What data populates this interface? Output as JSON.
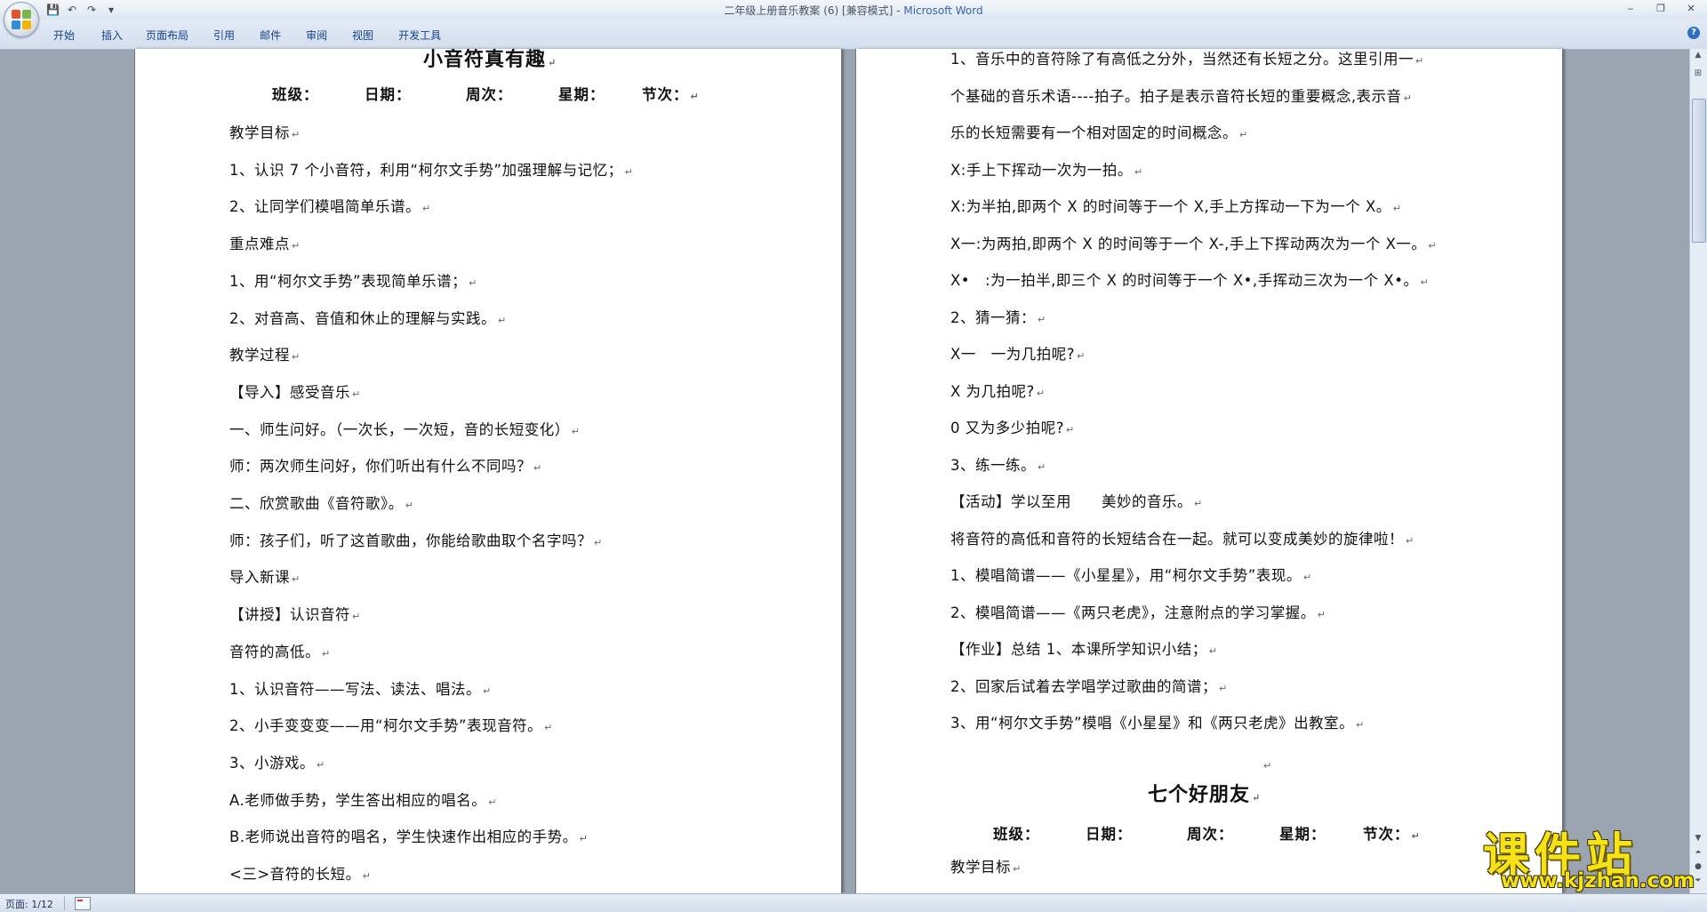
{
  "window": {
    "title": "二年级上册音乐教案 (6) [兼容模式]",
    "title_sep": " - ",
    "app_name": "Microsoft Word",
    "controls": [
      "‒",
      "❐",
      "✕"
    ]
  },
  "qat": {
    "save": "💾",
    "undo": "↶",
    "redo": "↷",
    "more": "▾"
  },
  "ribbon": {
    "tabs": [
      "开始",
      "插入",
      "页面布局",
      "引用",
      "邮件",
      "审阅",
      "视图",
      "开发工具"
    ],
    "help": "?"
  },
  "page1": {
    "title": "小音符真有趣",
    "header_fields": [
      "班级：",
      "日期：",
      "周次：",
      "星期：",
      "节次："
    ],
    "lines": [
      "教学目标",
      "1、认识 7 个小音符，利用“柯尔文手势”加强理解与记忆；",
      "2、让同学们模唱简单乐谱。",
      "重点难点",
      "1、用“柯尔文手势”表现简单乐谱；",
      "2、对音高、音值和休止的理解与实践。",
      "教学过程",
      "【导入】感受音乐",
      "一、师生问好。（一次长，一次短，音的长短变化）",
      "师：两次师生问好，你们听出有什么不同吗？",
      "二、欣赏歌曲《音符歌》。",
      "师：孩子们，听了这首歌曲，你能给歌曲取个名字吗？",
      "导入新课",
      "【讲授】认识音符",
      "音符的高低。",
      "1、认识音符——写法、读法、唱法。",
      "2、小手变变变——用“柯尔文手势”表现音符。",
      "3、小游戏。",
      "A.老师做手势，学生答出相应的唱名。",
      "B.老师说出音符的唱名，学生快速作出相应的手势。",
      "<三>音符的长短。"
    ]
  },
  "page2": {
    "lines": [
      "1、音乐中的音符除了有高低之分外，当然还有长短之分。这里引用一",
      "个基础的音乐术语----拍子。拍子是表示音符长短的重要概念,表示音",
      "乐的长短需要有一个相对固定的时间概念。",
      "X:手上下挥动一次为一拍。",
      "X:为半拍,即两个 X 的时间等于一个 X,手上方挥动一下为一个 X。",
      "X一:为两拍,即两个 X 的时间等于一个 X-,手上下挥动两次为一个 X一。",
      "X•　:为一拍半,即三个 X 的时间等于一个 X•,手挥动三次为一个 X•。",
      "2、猜一猜：",
      "X一　一为几拍呢?",
      "X 为几拍呢?",
      "0 又为多少拍呢?",
      "3、练一练。",
      "【活动】学以至用　　美妙的音乐。",
      "将音符的高低和音符的长短结合在一起。就可以变成美妙的旋律啦！",
      "1、模唱简谱——《小星星》，用“柯尔文手势”表现。",
      "2、模唱简谱——《两只老虎》，注意附点的学习掌握。",
      "【作业】总结 1、本课所学知识小结；",
      "2、回家后试着去学唱学过歌曲的简谱；",
      "3、用“柯尔文手势”模唱《小星星》和《两只老虎》出教室。"
    ],
    "title2": "七个好朋友",
    "header_fields": [
      "班级：",
      "日期：",
      "周次：",
      "星期：",
      "节次："
    ],
    "last_line": "教学目标"
  },
  "paragraph_mark": "↵",
  "status": {
    "page": "页面: 1/12"
  },
  "watermark": {
    "main": "课件站",
    "url": "www.kjzhan.com"
  },
  "colors": {
    "app_background": "#9ba5b2",
    "ribbon_text": "#15428b",
    "watermark": "#f5e318"
  }
}
